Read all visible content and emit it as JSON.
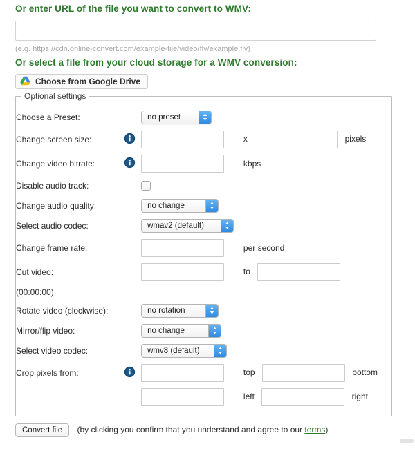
{
  "url_section": {
    "heading": "Or enter URL of the file you want to convert to WMV:",
    "input_value": "",
    "input_placeholder": "",
    "hint": "(e.g. https://cdn.online-convert.com/example-file/video/flv/example.flv)"
  },
  "cloud_section": {
    "heading": "Or select a file from your cloud storage for a WMV conversion:",
    "gdrive_button_label": "Choose from Google Drive",
    "gdrive_icon": "google-drive-icon"
  },
  "optional_settings": {
    "legend": "Optional settings",
    "rows": [
      {
        "label": "Choose a Preset:",
        "info": false,
        "control": "select",
        "value": "no preset"
      },
      {
        "label": "Change screen size:",
        "info": true,
        "control": "two-text",
        "value": "",
        "value2": "",
        "separator": "x",
        "unit": "pixels"
      },
      {
        "label": "Change video bitrate:",
        "info": true,
        "control": "text",
        "value": "",
        "unit": "kbps"
      },
      {
        "label": "Disable audio track:",
        "info": false,
        "control": "checkbox",
        "checked": false
      },
      {
        "label": "Change audio quality:",
        "info": false,
        "control": "select",
        "value": "no change"
      },
      {
        "label": "Select audio codec:",
        "info": false,
        "control": "select",
        "value": "wmav2 (default)"
      },
      {
        "label": "Change frame rate:",
        "info": false,
        "control": "text",
        "value": "",
        "unit": "per second"
      },
      {
        "label": "Cut video:",
        "info": false,
        "control": "two-text",
        "value": "",
        "value2": "",
        "separator": "to",
        "sub_label": "(00:00:00)"
      },
      {
        "label": "Rotate video (clockwise):",
        "info": false,
        "control": "select",
        "value": "no rotation"
      },
      {
        "label": "Mirror/flip video:",
        "info": false,
        "control": "select",
        "value": "no change"
      },
      {
        "label": "Select video codec:",
        "info": false,
        "control": "select",
        "value": "wmv8 (default)"
      },
      {
        "label": "Crop pixels from:",
        "info": true,
        "control": "crop",
        "crop": {
          "top_value": "",
          "top_label": "top",
          "bottom_value": "",
          "bottom_label": "bottom",
          "left_value": "",
          "left_label": "left",
          "right_value": "",
          "right_label": "right"
        }
      }
    ],
    "info_icon": "info-icon"
  },
  "footer": {
    "convert_label": "Convert file",
    "note_prefix": "(by clicking you confirm that you understand and agree to our ",
    "terms_label": "terms",
    "note_suffix": ")"
  },
  "colors": {
    "heading_green": "#2f7a2f",
    "link_green": "#2f7a2f",
    "select_arrow_blue": "#2f8ae0",
    "info_icon_blue": "#17466e",
    "fieldset_border": "#bdbdbd"
  }
}
